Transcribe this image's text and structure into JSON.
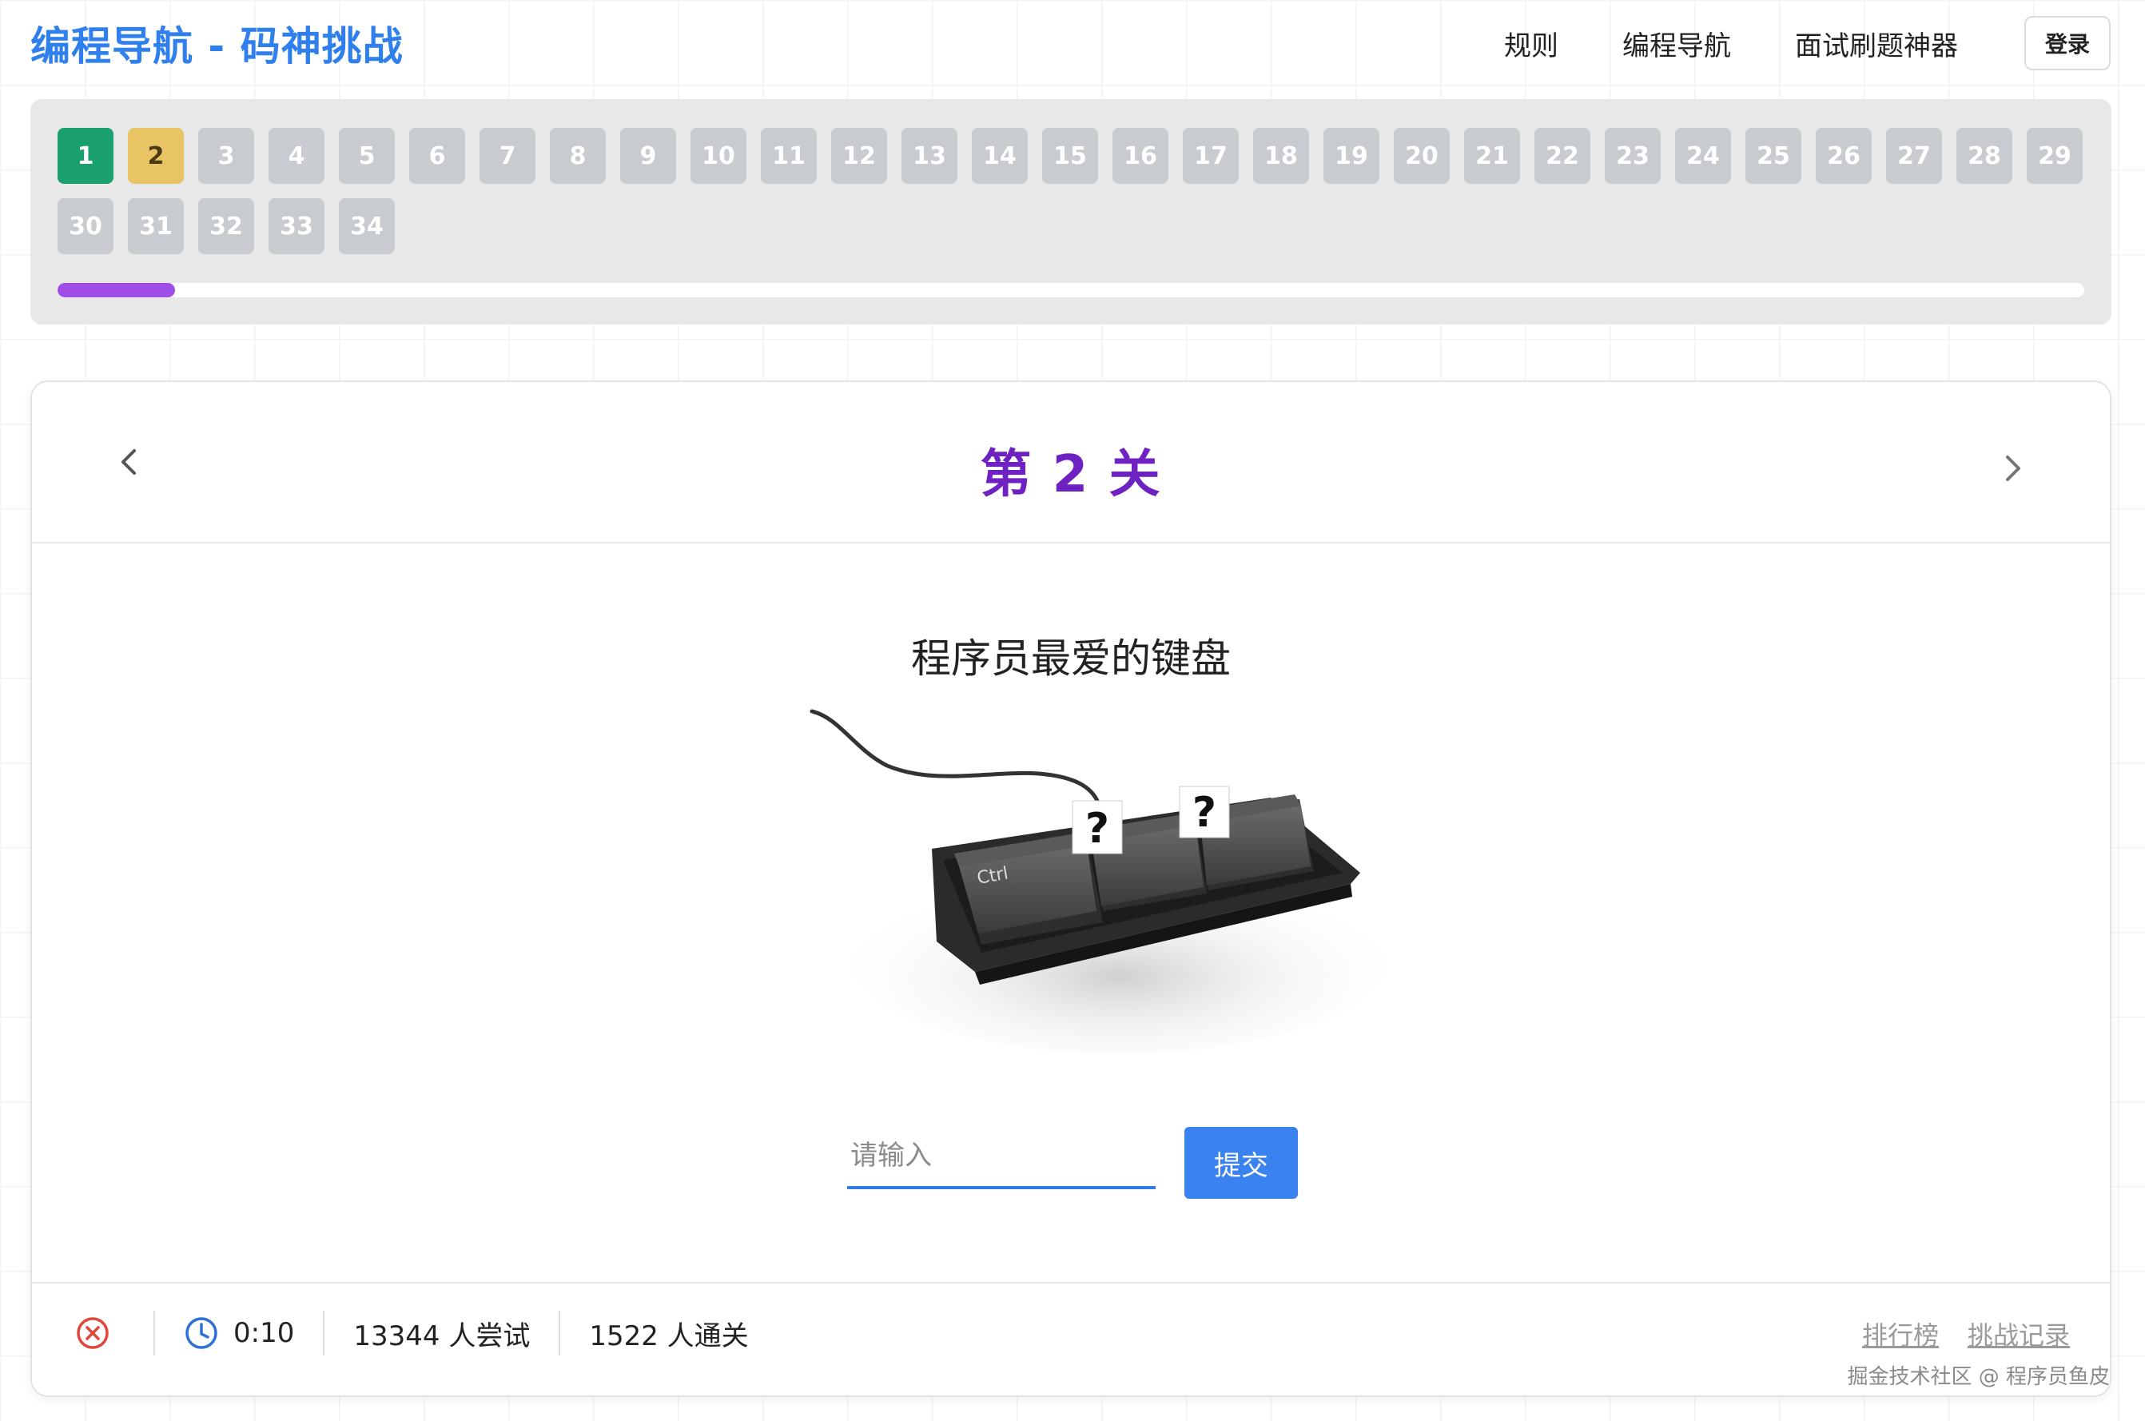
{
  "header": {
    "title": "编程导航 - 码神挑战",
    "nav": [
      "规则",
      "编程导航",
      "面试刷题神器"
    ],
    "login_label": "登录"
  },
  "levels": {
    "items": [
      "1",
      "2",
      "3",
      "4",
      "5",
      "6",
      "7",
      "8",
      "9",
      "10",
      "11",
      "12",
      "13",
      "14",
      "15",
      "16",
      "17",
      "18",
      "19",
      "20",
      "21",
      "22",
      "23",
      "24",
      "25",
      "26",
      "27",
      "28",
      "29",
      "30",
      "31",
      "32",
      "33",
      "34"
    ],
    "completed": [
      "1"
    ],
    "current": "2",
    "progress_fraction": 0.058
  },
  "level_card": {
    "title": "第 2 关",
    "question": "程序员最爱的键盘",
    "illustration": {
      "key_labels": [
        "Ctrl",
        "?",
        "?"
      ]
    },
    "answer_placeholder": "请输入",
    "answer_value": "",
    "submit_label": "提交"
  },
  "footer": {
    "timer": "0:10",
    "attempts": "13344 人尝试",
    "passed": "1522 人通关",
    "links": [
      "排行榜",
      "挑战记录"
    ]
  },
  "watermark": "掘金技术社区 @ 程序员鱼皮",
  "colors": {
    "accent": "#2f80ed",
    "title_purple": "#6e22c2",
    "completed": "#1aa06d",
    "current": "#e9c464",
    "progress": "#a04de8",
    "error": "#e0473c"
  },
  "icons": [
    "chevron-left-icon",
    "chevron-right-icon",
    "close-circle-icon",
    "clock-icon"
  ]
}
